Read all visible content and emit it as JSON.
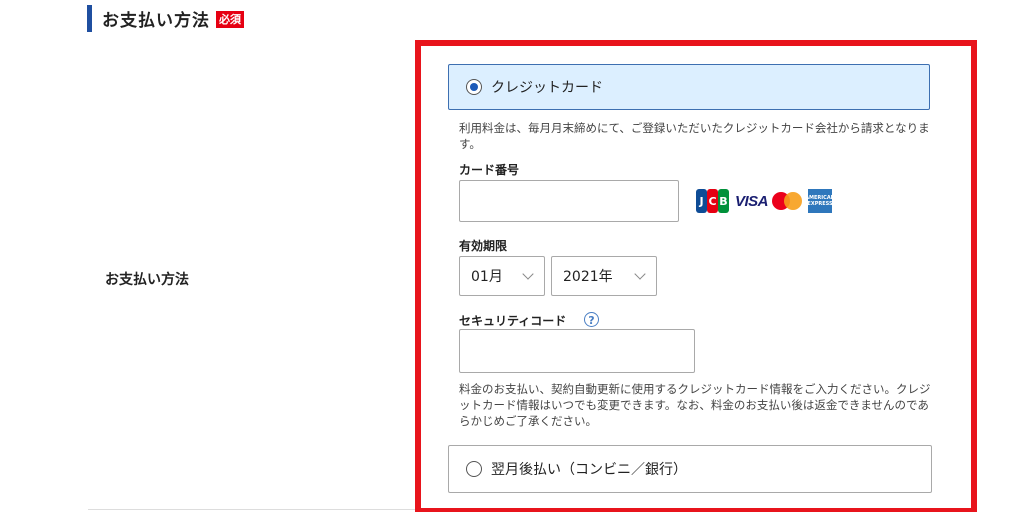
{
  "section": {
    "title": "お支払い方法",
    "required_badge": "必須"
  },
  "row_label": "お支払い方法",
  "payment_options": {
    "credit_card": {
      "label": "クレジットカード",
      "selected": true,
      "description": "利用料金は、毎月月末締めにて、ご登録いただいたクレジットカード会社から請求となります。"
    },
    "deferred": {
      "label": "翌月後払い（コンビニ／銀行）",
      "selected": false
    }
  },
  "card_form": {
    "card_number_label": "カード番号",
    "card_number_value": "",
    "expiry_label": "有効期限",
    "expiry_month": "01月",
    "expiry_year": "2021年",
    "security_code_label": "セキュリティコード",
    "security_code_value": "",
    "help_symbol": "?",
    "note": "料金のお支払い、契約自動更新に使用するクレジットカード情報をご入力ください。クレジットカード情報はいつでも変更できます。なお、料金のお支払い後は返金できませんのであらかじめご了承ください。"
  },
  "brands": {
    "jcb": [
      "J",
      "C",
      "B"
    ],
    "visa": "VISA",
    "amex": "AMERICAN EXPRESS"
  },
  "icons": {
    "radio_checked": "radio-checked-icon",
    "radio_unchecked": "radio-unchecked-icon",
    "chevron": "chevron-down-icon",
    "help": "question-circle-icon"
  },
  "colors": {
    "accent_blue": "#1f4fa0",
    "required_red": "#e60012",
    "highlight_red": "#e8141c",
    "selected_bg": "#dcefff",
    "selected_border": "#3d6fb1"
  }
}
